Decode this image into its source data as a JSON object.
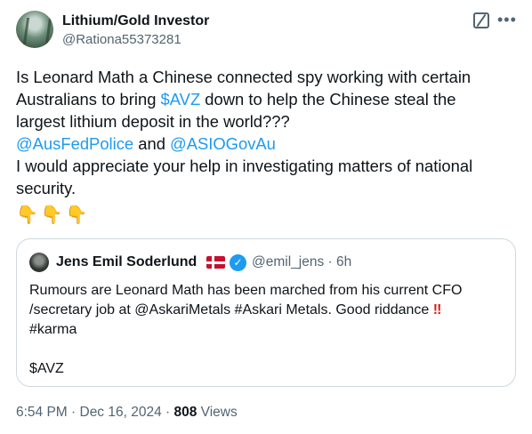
{
  "author": {
    "name": "Lithium/Gold Investor",
    "handle": "@Rationa55373281"
  },
  "tweet": {
    "line1": "Is Leonard Math a Chinese connected spy working with certain",
    "line2_pre": "Australians to bring ",
    "cashtag": "$AVZ",
    "line2_post": " down to help the Chinese steal the",
    "line3": "largest lithium deposit in the world???",
    "mention1": "@AusFedPolice",
    "and": " and ",
    "mention2": "@ASIOGovAu",
    "line5": "I would appreciate your help in investigating matters of national",
    "line6": "security.",
    "emoji": "👇"
  },
  "quote": {
    "name": "Jens Emil Soderlund",
    "handle_time": "@emil_jens · 6h",
    "line1": "Rumours are Leonard Math has been marched from his current CFO",
    "line2_pre": "/secretary job at @AskariMetals #Askari Metals. Good riddance ",
    "bang": "‼",
    "line3": "#karma",
    "line4": "$AVZ"
  },
  "meta": {
    "timestamp": "6:54 PM · Dec 16, 2024 · ",
    "views_count": "808",
    "views_label": " Views"
  },
  "colors": {
    "link": "#1d9bf0",
    "secondary_text": "#536471",
    "border": "#cfd9de"
  }
}
